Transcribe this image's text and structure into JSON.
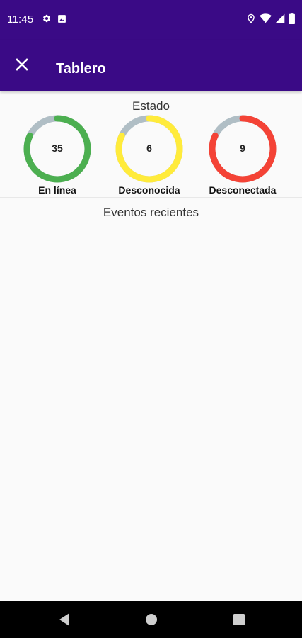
{
  "status_bar": {
    "time": "11:45",
    "icons": [
      "settings-icon",
      "image-icon",
      "location-icon",
      "wifi-icon",
      "signal-icon",
      "battery-icon"
    ]
  },
  "app_bar": {
    "close_icon": "close-icon",
    "title": "Tablero",
    "background": "#3a0a86"
  },
  "status_section": {
    "title": "Estado",
    "gauges": [
      {
        "label": "En línea",
        "value": "35",
        "fraction": 0.82,
        "color": "#4caf50",
        "track_color": "#b0bec5"
      },
      {
        "label": "Desconocida",
        "value": "6",
        "fraction": 0.82,
        "color": "#ffeb3b",
        "track_color": "#b0bec5"
      },
      {
        "label": "Desconectada",
        "value": "9",
        "fraction": 0.82,
        "color": "#f44336",
        "track_color": "#b0bec5"
      }
    ]
  },
  "events_section": {
    "title": "Eventos recientes"
  },
  "nav_bar": {
    "icons": [
      "back-icon",
      "home-icon",
      "recents-icon"
    ]
  }
}
